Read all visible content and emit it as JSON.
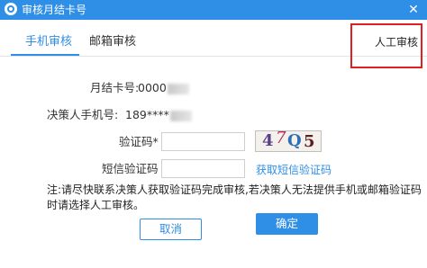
{
  "window": {
    "title": "审核月结卡号",
    "close_symbol": "✕"
  },
  "tabs": {
    "phone_review": "手机审核",
    "email_review": "邮箱审核",
    "manual_review": "人工审核"
  },
  "form": {
    "card_label": "月结卡号:",
    "card_value": "0000",
    "phone_label": "决策人手机号:",
    "phone_value": "189****",
    "captcha_label": "验证码*",
    "captcha_input_value": "",
    "captcha_chars": [
      "4",
      "7",
      "Q",
      "5"
    ],
    "sms_label": "短信验证码",
    "sms_input_value": "",
    "sms_link": "获取短信验证码"
  },
  "notice": "注:请尽快联系决策人获取验证码完成审核,若决策人无法提供手机或邮箱验证码时请选择人工审核。",
  "buttons": {
    "cancel": "取消",
    "confirm": "确定"
  },
  "colors": {
    "accent": "#2f8ee6",
    "highlight_box": "#e02020"
  }
}
